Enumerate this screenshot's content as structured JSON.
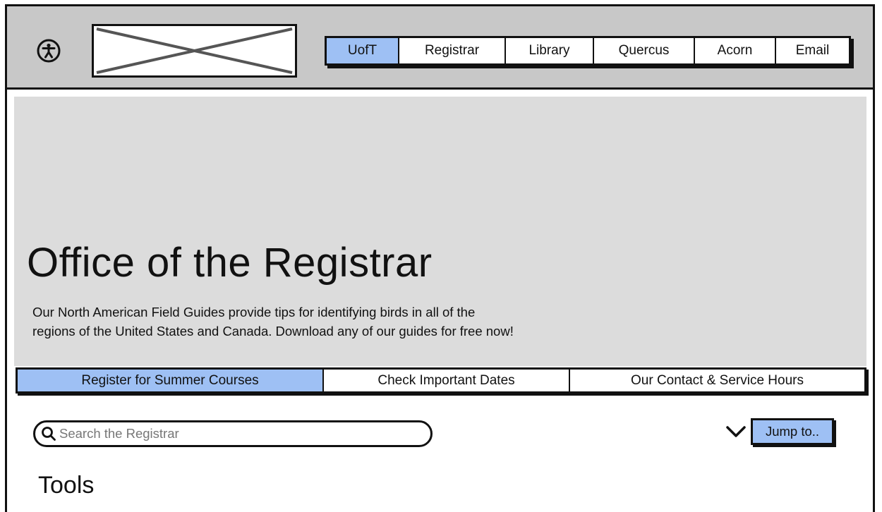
{
  "header": {
    "logo_alt": "Logo placeholder",
    "nav": [
      {
        "label": "UofT",
        "active": true
      },
      {
        "label": "Registrar",
        "active": false
      },
      {
        "label": "Library",
        "active": false
      },
      {
        "label": "Quercus",
        "active": false
      },
      {
        "label": "Acorn",
        "active": false
      },
      {
        "label": "Email",
        "active": false
      }
    ]
  },
  "hero": {
    "title": "Office of the Registrar",
    "description_line1": "Our North American Field Guides provide tips for identifying birds in all of the",
    "description_line2": "regions of the United States and Canada. Download any of our guides for free now!"
  },
  "tabs": [
    {
      "label": "Register for Summer Courses",
      "active": true
    },
    {
      "label": "Check Important Dates",
      "active": false
    },
    {
      "label": "Our Contact & Service Hours",
      "active": false
    }
  ],
  "search": {
    "placeholder": "Search the Registrar",
    "value": ""
  },
  "jump": {
    "label": "Jump to.."
  },
  "tools": {
    "heading": "Tools"
  },
  "colors": {
    "accent": "#9ec0f4",
    "header_bg": "#c8c8c8",
    "hero_bg": "#dcdcdc"
  },
  "icons": {
    "accessibility": "accessibility-icon",
    "search": "search-icon",
    "chevron": "chevron-down-icon"
  }
}
